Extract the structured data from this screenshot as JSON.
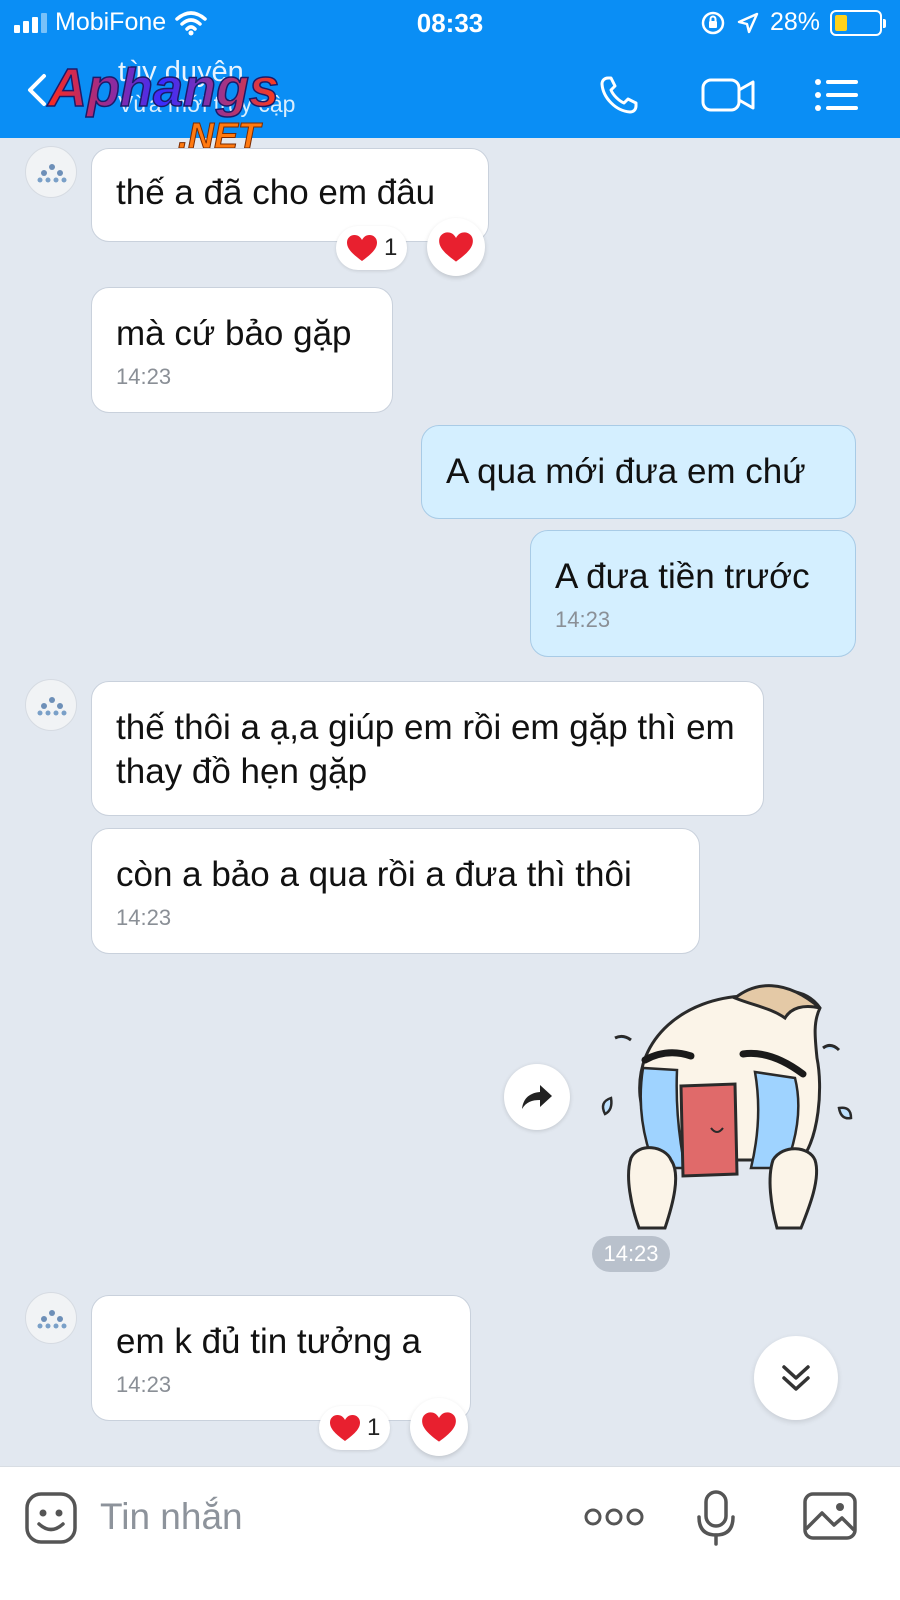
{
  "status_bar": {
    "carrier": "MobiFone",
    "time": "08:33",
    "battery": "28%",
    "battery_level": 0.28
  },
  "header": {
    "contact_name": "tùy duyên",
    "contact_status": "Vừa mới truy cập",
    "watermark": "Aphangs .NET"
  },
  "messages": [
    {
      "text": "thế a đã cho em đâu",
      "time": "",
      "reactions": {
        "count": "1"
      }
    },
    {
      "text": "mà cứ bảo gặp",
      "time": "14:23"
    },
    {
      "text": "A qua mới đưa em chứ",
      "time": ""
    },
    {
      "text": "A đưa tiền trước",
      "time": "14:23"
    },
    {
      "text": "thế thôi a ạ,a giúp em rồi em gặp thì em thay đồ hẹn gặp",
      "time": ""
    },
    {
      "text": "còn a bảo a qua rồi a đưa thì thôi",
      "time": "14:23"
    },
    {
      "text": "em k đủ tin tưởng a",
      "time": "14:23",
      "reactions": {
        "count": "1"
      }
    }
  ],
  "sticker": {
    "time": "14:23"
  },
  "input": {
    "placeholder": "Tin nhắn"
  },
  "colors": {
    "header": "#0a8ef5",
    "chat_bg": "#e2e8f0",
    "outgoing_bubble": "#d4efff",
    "incoming_bubble": "#ffffff",
    "heart": "#e8202f",
    "battery_fill": "#ffd21a"
  },
  "icons": [
    "signal-icon",
    "wifi-icon",
    "rotation-lock-icon",
    "location-icon",
    "battery-icon",
    "back-icon",
    "phone-icon",
    "video-icon",
    "menu-icon",
    "heart-icon",
    "share-icon",
    "chevron-double-down-icon",
    "emoji-icon",
    "more-icon",
    "microphone-icon",
    "image-icon"
  ]
}
